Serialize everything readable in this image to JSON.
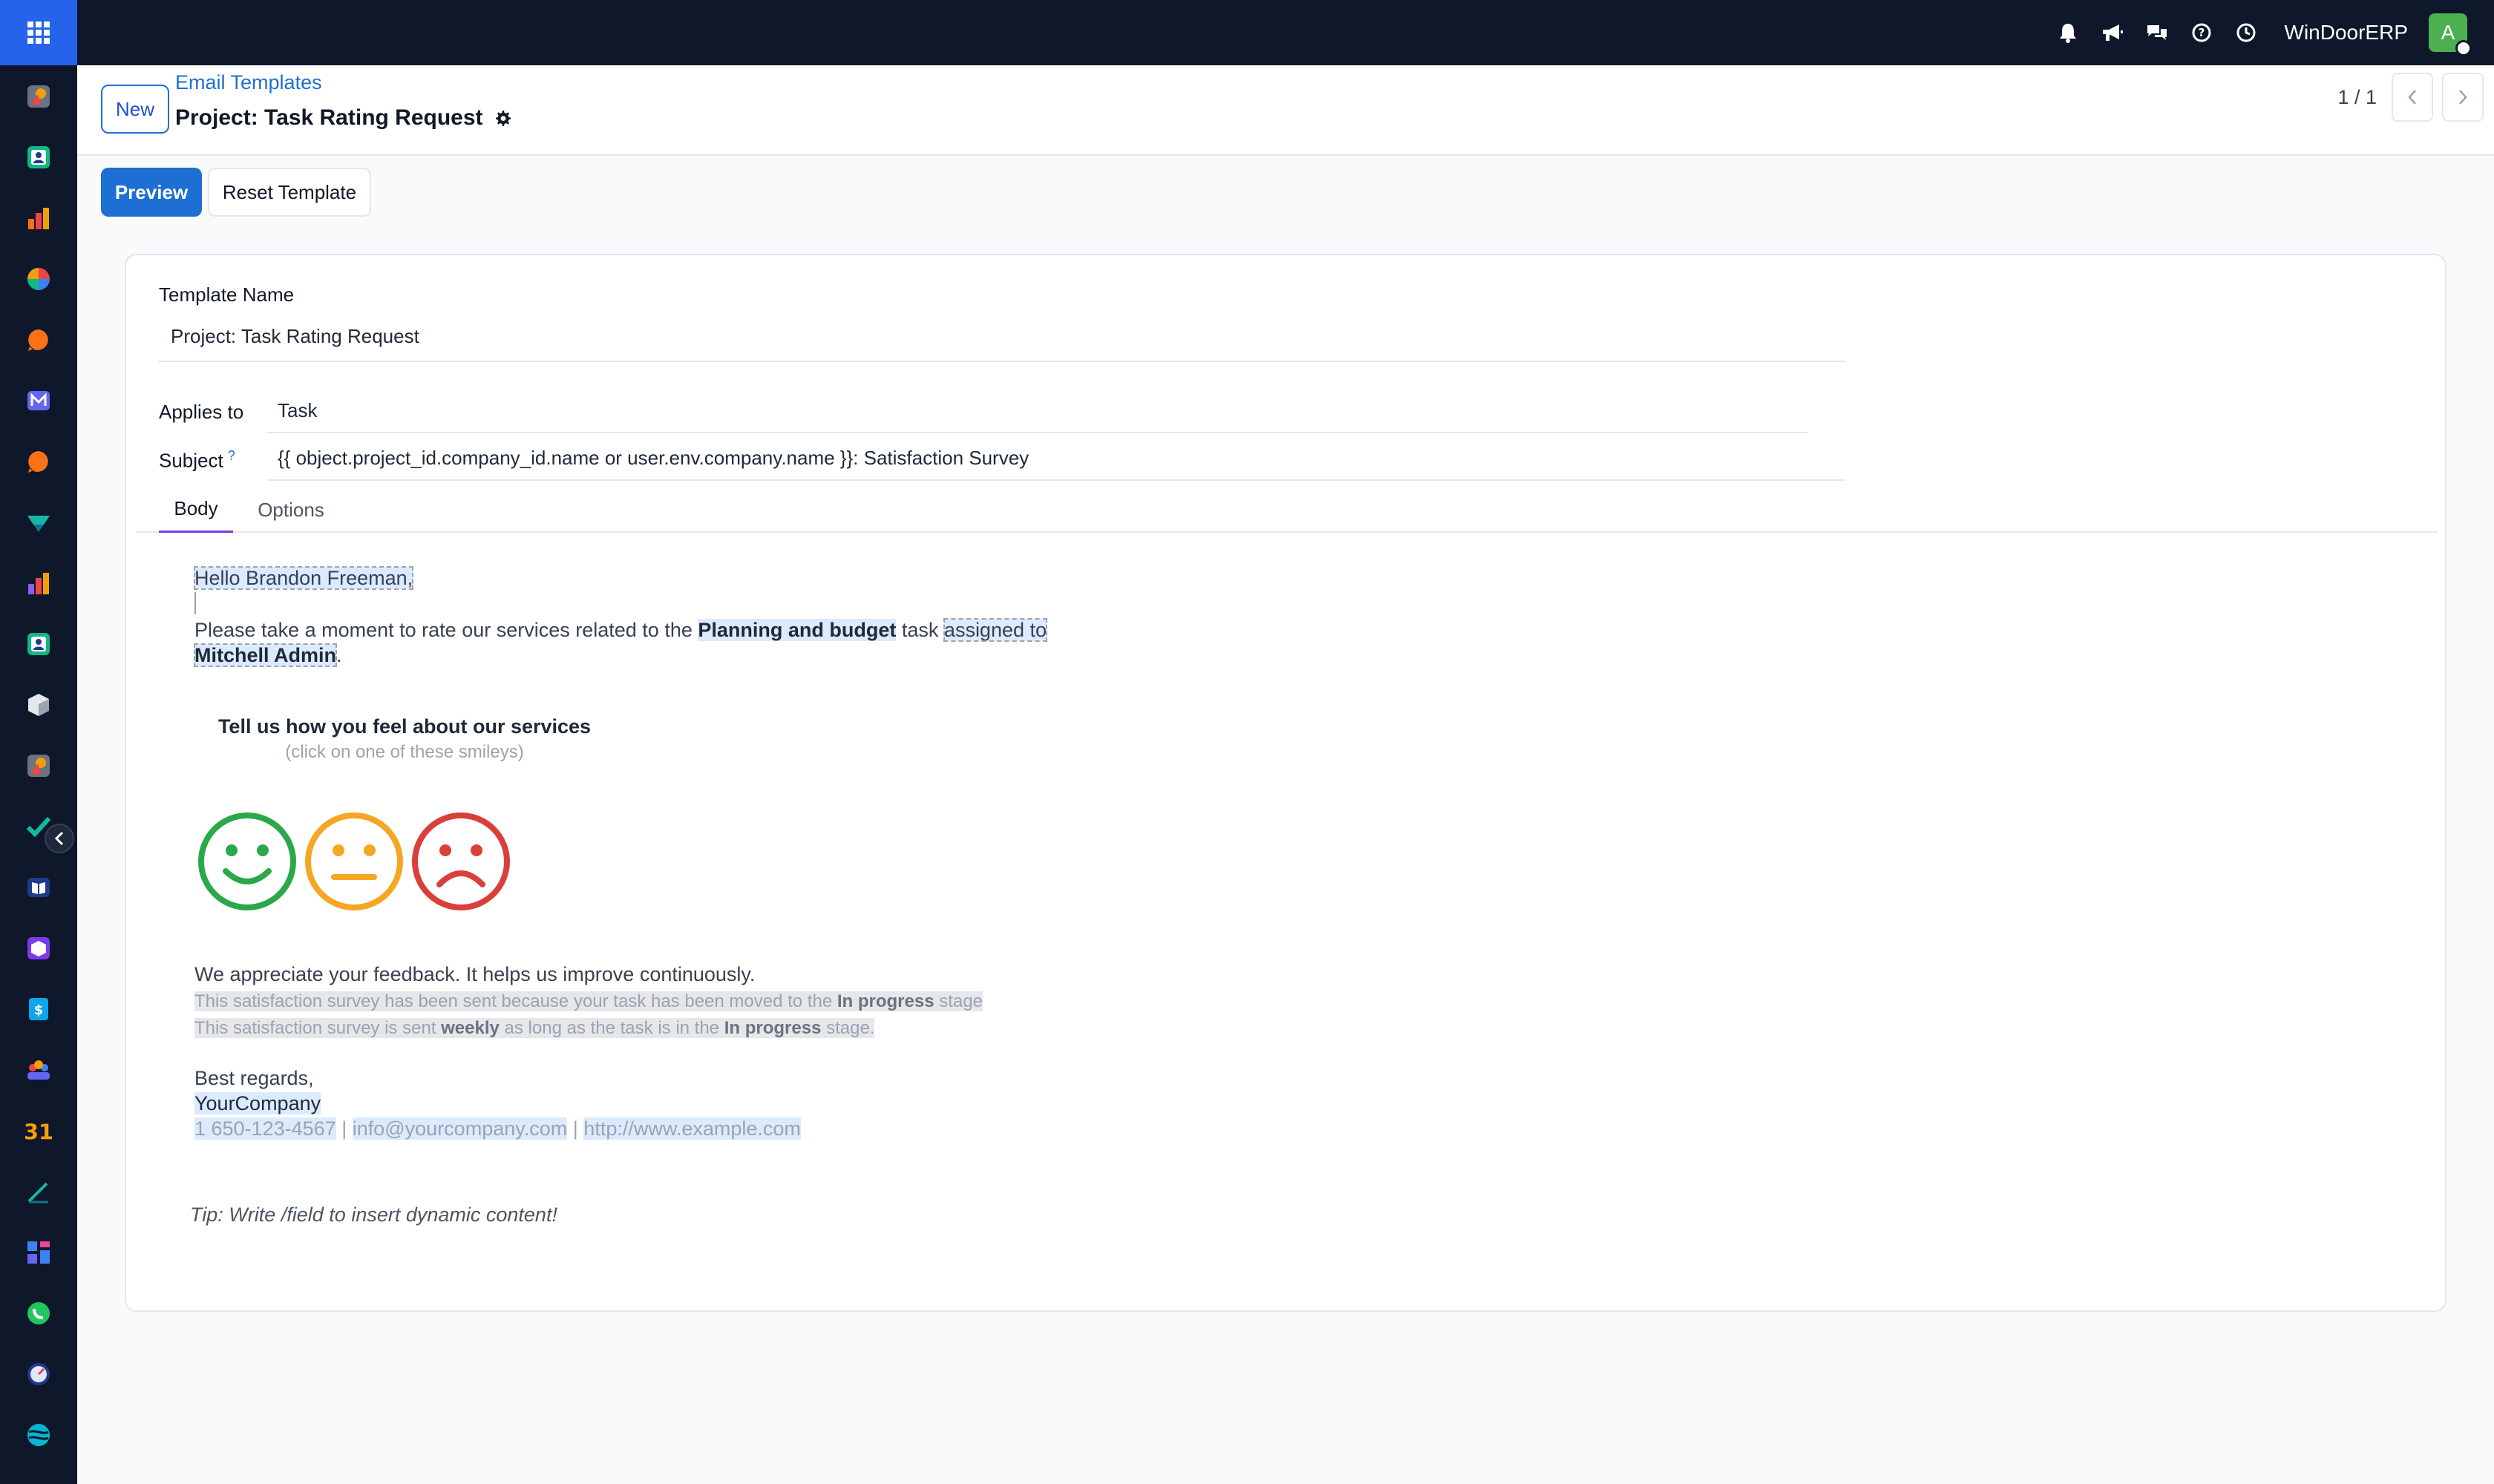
{
  "app": {
    "company_name": "WinDoorERP",
    "user_initial": "A"
  },
  "topbar": {
    "icons": [
      "bell-icon",
      "megaphone-icon",
      "chat-icon",
      "help-icon",
      "clock-icon"
    ]
  },
  "sidebar": {
    "apps": [
      "discuss",
      "contacts",
      "sales",
      "dashboards",
      "livechat",
      "email-marketing",
      "helpdesk",
      "project",
      "reporting",
      "employees",
      "inventory",
      "planning",
      "todo",
      "knowledge",
      "manufacturing",
      "invoicing",
      "crm",
      "calendar",
      "sign",
      "documents",
      "whatsapp",
      "field-service",
      "website"
    ]
  },
  "control_panel": {
    "new_label": "New",
    "breadcrumb": "Email Templates",
    "title": "Project: Task Rating Request",
    "pager": "1 / 1"
  },
  "actions": {
    "preview_label": "Preview",
    "reset_label": "Reset Template"
  },
  "form": {
    "template_name_label": "Template Name",
    "template_name_value": "Project: Task Rating Request",
    "applies_to_label": "Applies to",
    "applies_to_value": "Task",
    "subject_label": "Subject",
    "subject_help": "?",
    "subject_value": "{{ object.project_id.company_id.name or user.env.company.name }}: Satisfaction Survey"
  },
  "tabs": {
    "body": "Body",
    "options": "Options"
  },
  "body": {
    "greeting_hello": "Hello",
    "greeting_name": "Brandon Freeman",
    "greeting_comma": ",",
    "intro_text": "Please take a moment to rate our services related to the",
    "task_name": "Planning and budget",
    "task_word": "task",
    "assigned_to": "assigned to",
    "assignee": "Mitchell Admin",
    "period": ".",
    "survey_title": "Tell us how you feel about our services",
    "survey_sub": "(click on one of these smileys)",
    "feedback": "We appreciate your feedback. It helps us improve continuously.",
    "note1_pre": "This satisfaction survey has been sent because your task has been moved to the",
    "note1_stage": "In progress",
    "note1_post": "stage",
    "note2_pre": "This satisfaction survey is sent",
    "note2_freq": "weekly",
    "note2_mid": "as long as the task is in the",
    "note2_stage": "In progress",
    "note2_post": "stage.",
    "regards": "Best regards,",
    "company": "YourCompany",
    "phone": "1 650-123-4567",
    "sep": "|",
    "email": "info@yourcompany.com",
    "website": "http://www.example.com",
    "tip": "Tip: Write /field to insert dynamic content!"
  },
  "colors": {
    "accent": "#1d6fd3",
    "navbar": "#0f172a",
    "happy": "#2ba84a",
    "neutral": "#f5a623",
    "sad": "#d9403a"
  }
}
